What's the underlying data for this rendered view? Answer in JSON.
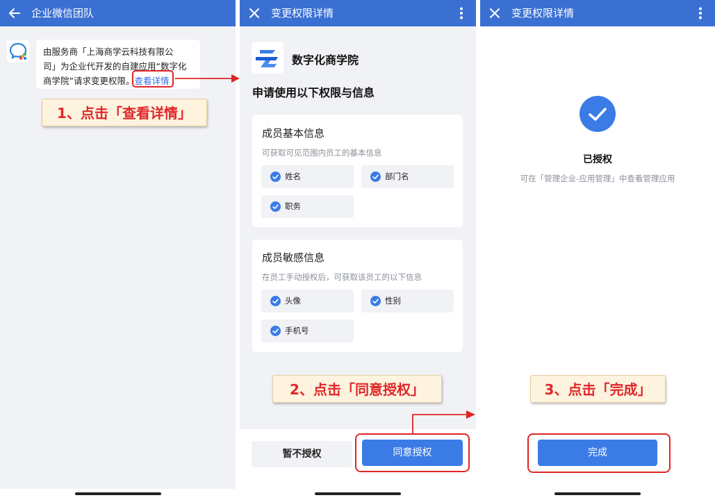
{
  "panel1": {
    "title": "企业微信团队",
    "message": {
      "line1": "由服务商「上海商学云科技有限公",
      "line2": "司」为企业代开发的自建应用“数字化",
      "line3_prefix": "商学院”请求变更权限。",
      "link": "查看详情"
    },
    "callout": "1、点击「查看详情」"
  },
  "panel2": {
    "title": "变更权限详情",
    "app_name": "数字化商学院",
    "request_title": "申请使用以下权限与信息",
    "basic_card": {
      "title": "成员基本信息",
      "desc": "可获取可见范围内员工的基本信息",
      "items": [
        "姓名",
        "部门名",
        "职务"
      ]
    },
    "sensitive_card": {
      "title": "成员敏感信息",
      "desc": "在员工手动授权后，可获取该员工的以下信息",
      "items": [
        "头像",
        "性别",
        "手机号"
      ]
    },
    "callout": "2、点击「同意授权」",
    "decline_label": "暂不授权",
    "agree_label": "同意授权"
  },
  "panel3": {
    "title": "变更权限详情",
    "success_title": "已授权",
    "success_desc": "可在「管理企业-应用管理」中查看管理应用",
    "callout": "3、点击「完成」",
    "done_label": "完成"
  },
  "colors": {
    "header": "#3b70d3",
    "primary_button": "#3b7be6",
    "highlight": "#e02424",
    "callout_bg": "#fdf3de",
    "callout_text": "#e0272b"
  },
  "icons": {
    "back": "back-arrow-icon",
    "close": "close-icon",
    "more": "more-vertical-icon",
    "check": "check-circle-icon",
    "success": "success-check-icon"
  }
}
